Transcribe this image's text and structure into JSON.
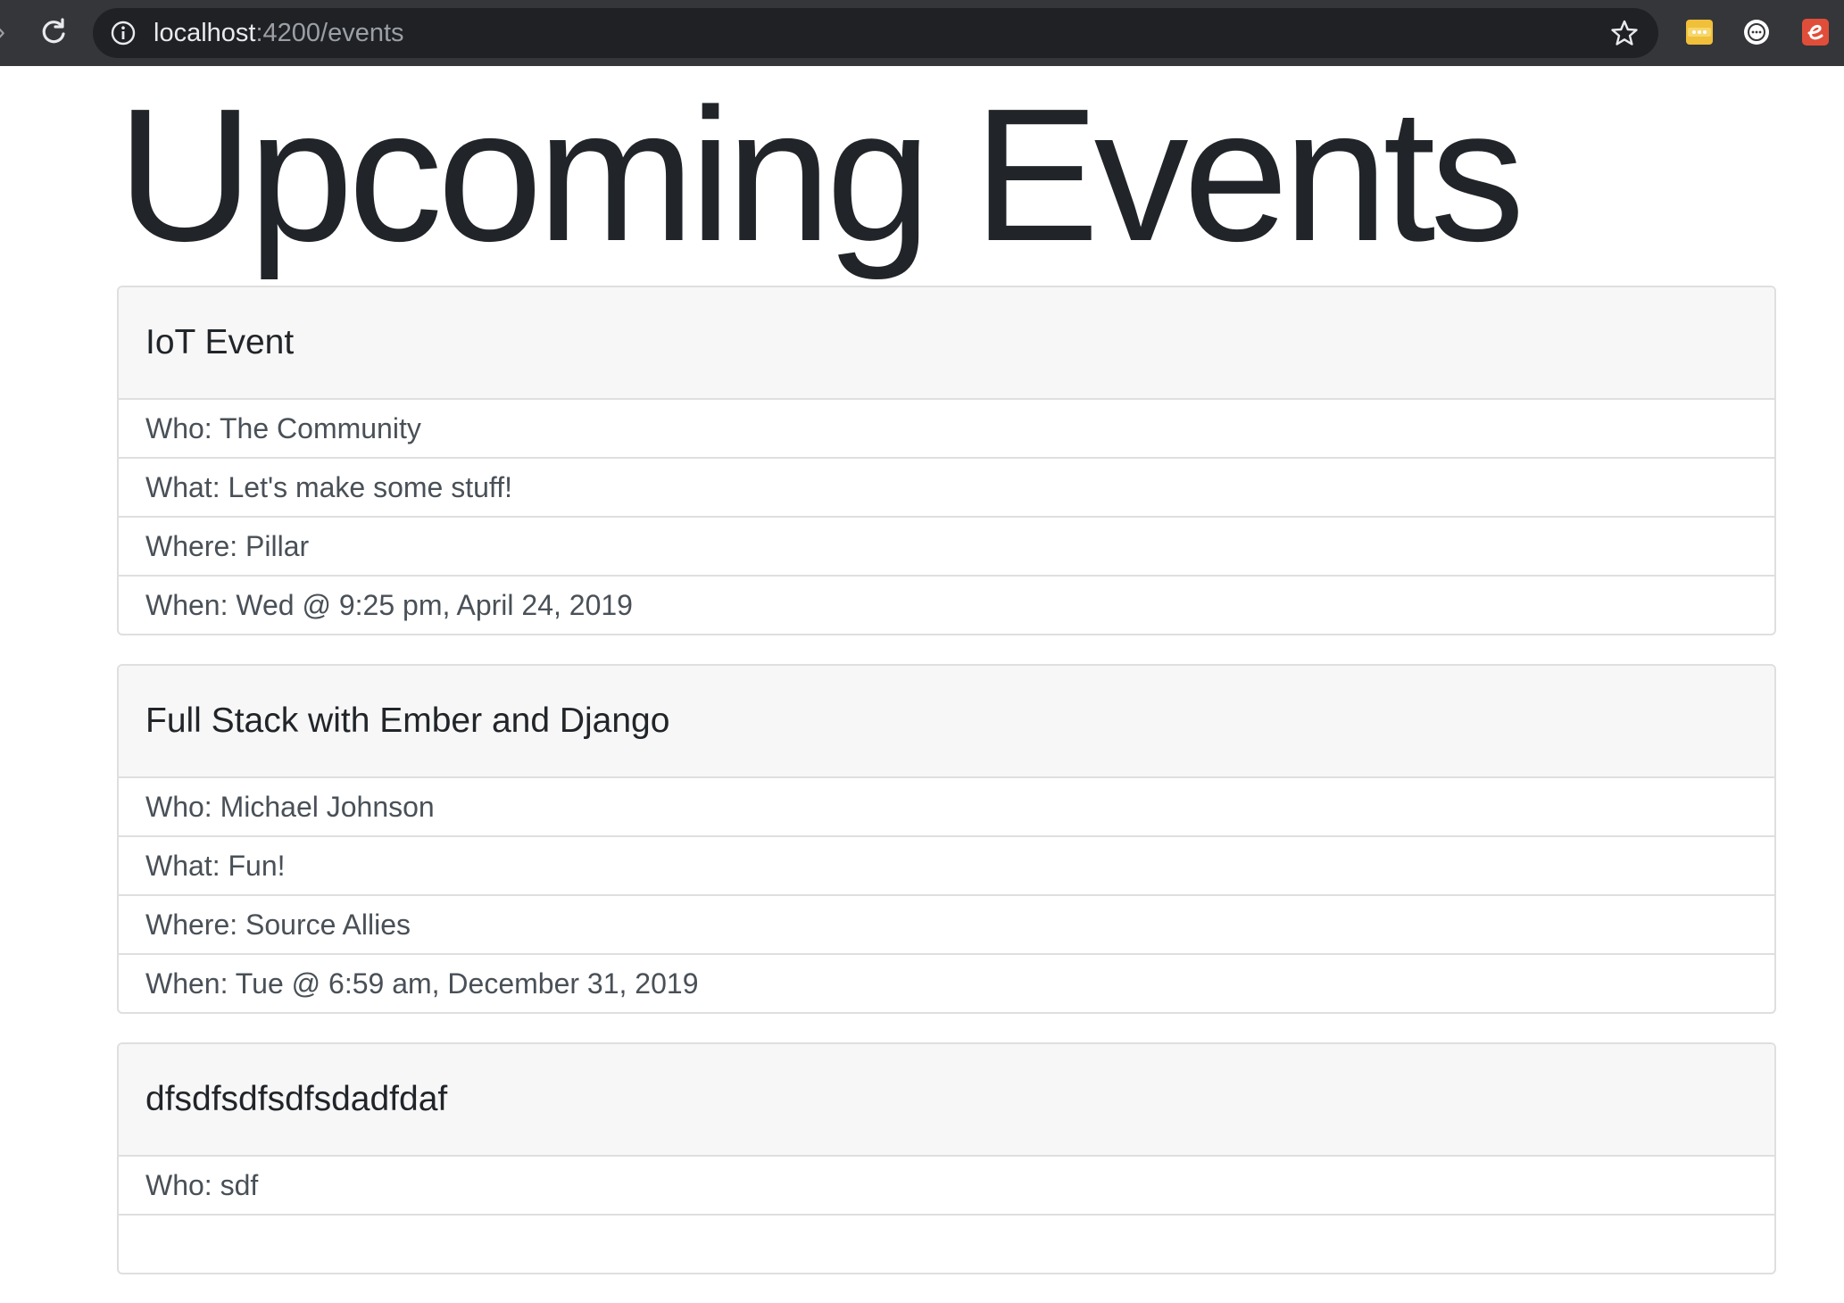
{
  "browser": {
    "url_host": "localhost",
    "url_rest": ":4200/events",
    "icons": {
      "back": "back-arrow-icon",
      "reload": "reload-icon",
      "info": "info-icon",
      "star": "star-icon",
      "extensions": [
        "password-manager-icon",
        "extension-icon",
        "ember-inspector-icon"
      ]
    },
    "colors": {
      "toolbar": "#35363a",
      "omnibox": "#202124",
      "ext_yellow": "#f0c03a",
      "ext_red": "#e04e39"
    }
  },
  "page": {
    "title": "Upcoming Events"
  },
  "events": [
    {
      "name": "IoT Event",
      "who": "Who: The Community",
      "what": "What: Let's make some stuff!",
      "where": "Where: Pillar",
      "when": "When: Wed @ 9:25 pm, April 24, 2019"
    },
    {
      "name": "Full Stack with Ember and Django",
      "who": "Who: Michael Johnson",
      "what": "What: Fun!",
      "where": "Where: Source Allies",
      "when": "When: Tue @ 6:59 am, December 31, 2019"
    },
    {
      "name": "dfsdfsdfsdfsdadfdaf",
      "who": "Who: sdf"
    }
  ]
}
